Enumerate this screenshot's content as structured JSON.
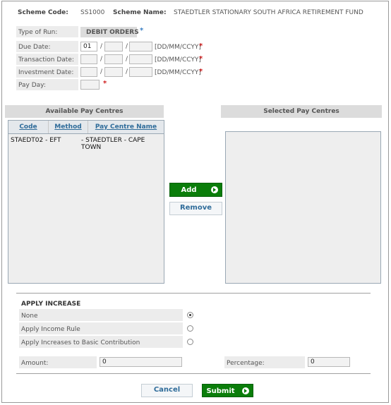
{
  "scheme": {
    "code_label": "Scheme Code:",
    "code_value": "SS1000",
    "name_label": "Scheme Name:",
    "name_value": "STAEDTLER STATIONARY SOUTH AFRICA RETIREMENT FUND"
  },
  "run_type": {
    "label": "Type of Run:",
    "value": "DEBIT ORDERS",
    "required": "*"
  },
  "dates": {
    "due": {
      "label": "Due Date:",
      "day": "01",
      "month": "",
      "year": "",
      "format": "[DD/MM/CCYY]",
      "required": "*"
    },
    "transaction": {
      "label": "Transaction Date:",
      "day": "",
      "month": "",
      "year": "",
      "format": "[DD/MM/CCYY]",
      "required": "*"
    },
    "investment": {
      "label": "Investment Date:",
      "day": "",
      "month": "",
      "year": "",
      "format": "[DD/MM/CCYY]",
      "required": "*"
    },
    "separator": "/"
  },
  "pay_day": {
    "label": "Pay Day:",
    "value": "",
    "required": "*"
  },
  "available": {
    "title": "Available Pay Centres",
    "columns": [
      "Code",
      "Method",
      "Pay Centre Name"
    ],
    "rows": [
      {
        "code": "STAEDT02 - EFT",
        "name": "- STAEDTLER - CAPE TOWN"
      }
    ]
  },
  "selected": {
    "title": "Selected Pay Centres"
  },
  "buttons": {
    "add": "Add",
    "remove": "Remove",
    "cancel": "Cancel",
    "submit": "Submit"
  },
  "apply_increase": {
    "title": "APPLY INCREASE",
    "options": [
      {
        "label": "None",
        "selected": true
      },
      {
        "label": "Apply Income Rule",
        "selected": false
      },
      {
        "label": "Apply Increases to Basic Contribution",
        "selected": false
      }
    ],
    "amount_label": "Amount:",
    "amount_value": "0",
    "percentage_label": "Percentage:",
    "percentage_value": "0"
  },
  "colors": {
    "accent_green": "#0a7d0a",
    "link_blue": "#2f6c9a",
    "required_red": "#d02020",
    "required_blue": "#3a7fc4"
  }
}
